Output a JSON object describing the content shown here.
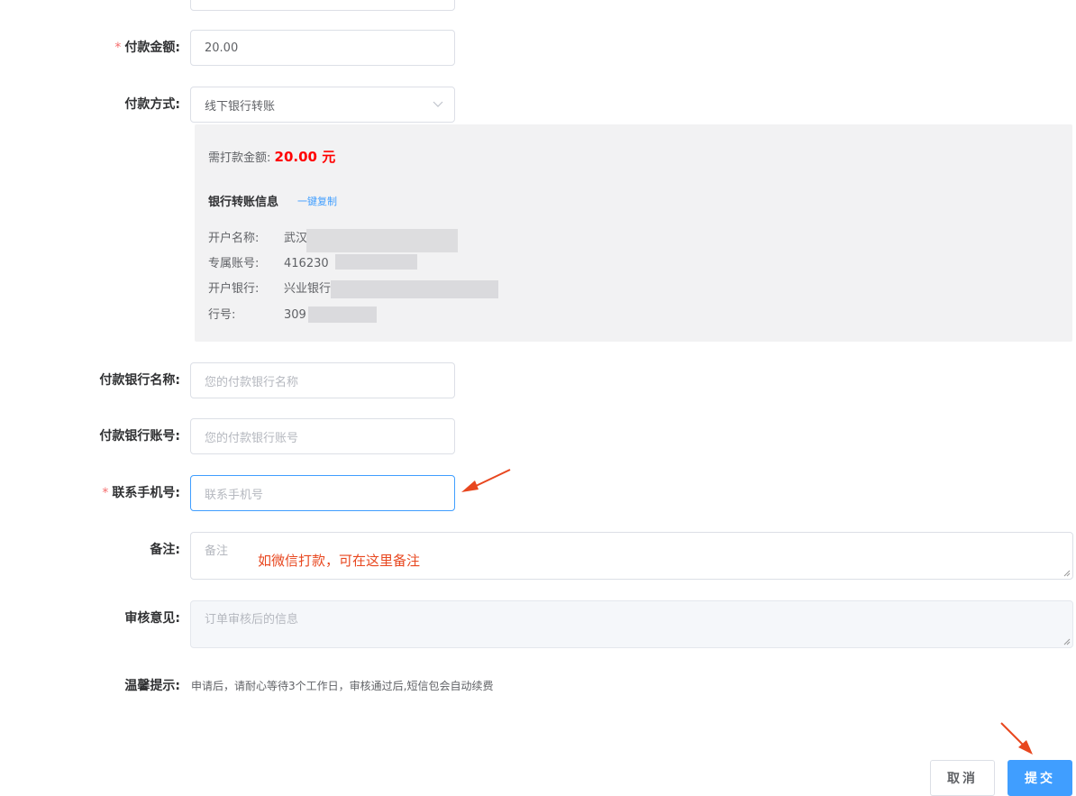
{
  "form": {
    "amount": {
      "label": "付款金额:",
      "value": "20.00",
      "required_mark": "*"
    },
    "method": {
      "label": "付款方式:",
      "value": "线下银行转账"
    },
    "bank_name": {
      "label": "付款银行名称:",
      "placeholder": "您的付款银行名称"
    },
    "bank_account": {
      "label": "付款银行账号:",
      "placeholder": "您的付款银行账号"
    },
    "phone": {
      "label": "联系手机号:",
      "placeholder": "联系手机号",
      "required_mark": "*"
    },
    "remark": {
      "label": "备注:",
      "placeholder": "备注"
    },
    "review": {
      "label": "审核意见:",
      "placeholder": "订单审核后的信息"
    },
    "tip": {
      "label": "温馨提示:",
      "text": "申请后，请耐心等待3个工作日，审核通过后,短信包会自动续费"
    }
  },
  "transfer_info": {
    "due_label": "需打款金额:",
    "due_amount": "20.00 元",
    "section_title": "银行转账信息",
    "copy_link": "一键复制",
    "rows": [
      {
        "key": "开户名称:",
        "value": "武汉"
      },
      {
        "key": "专属账号:",
        "value": "416230"
      },
      {
        "key": "开户银行:",
        "value": "兴业银行"
      },
      {
        "key": "行号:",
        "value": "309"
      }
    ]
  },
  "annotation": {
    "remark_hint": "如微信打款，可在这里备注"
  },
  "actions": {
    "cancel": "取消",
    "submit": "提交"
  },
  "colors": {
    "primary": "#409eff",
    "danger": "#f56c6c",
    "amount_red": "#ff0000",
    "arrow": "#e8471f"
  }
}
